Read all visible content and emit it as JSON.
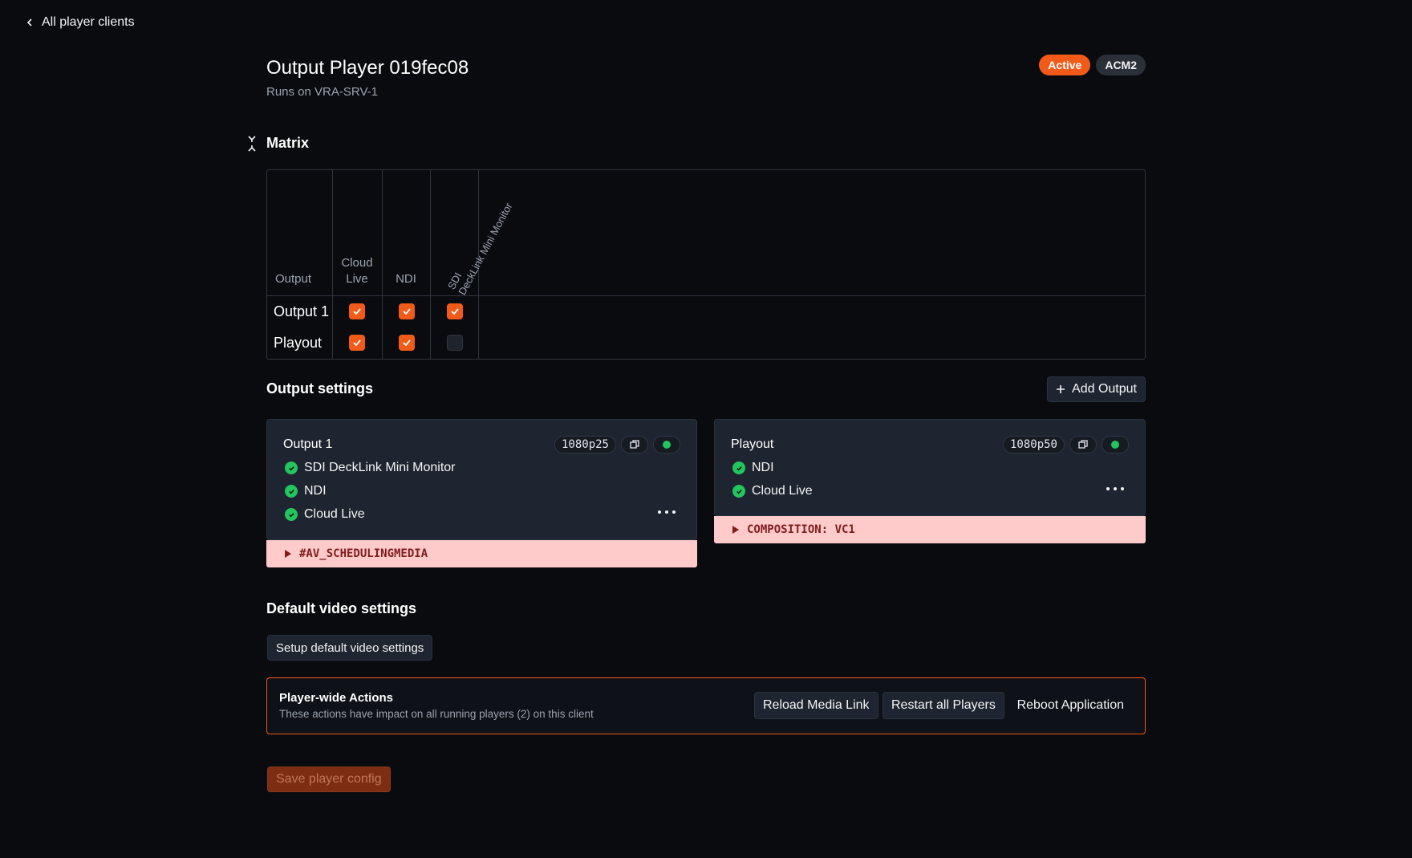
{
  "nav": {
    "back_label": "All player clients"
  },
  "header": {
    "title": "Output Player 019fec08",
    "subtitle": "Runs on VRA-SRV-1",
    "badges": {
      "status": "Active",
      "tag": "ACM2"
    },
    "colors": {
      "accent": "#f25a1a",
      "success": "#22c55e",
      "warning_bg": "#fecaca",
      "warning_text": "#7f1d1d"
    }
  },
  "matrix": {
    "title": "Matrix",
    "headers": {
      "output": "Output",
      "cloud_live_1": "Cloud",
      "cloud_live_2": "Live",
      "ndi": "NDI",
      "sdi_1": "SDI",
      "sdi_2": "DeckLink Mini Monitor"
    },
    "rows": [
      {
        "label": "Output 1",
        "cloud_live": true,
        "ndi": true,
        "sdi": true
      },
      {
        "label": "Playout",
        "cloud_live": true,
        "ndi": true,
        "sdi": false
      }
    ]
  },
  "output_settings": {
    "title": "Output settings",
    "add_label": "Add Output",
    "cards": [
      {
        "title": "Output 1",
        "resolution": "1080p25",
        "items": [
          "SDI DeckLink Mini Monitor",
          "NDI",
          "Cloud Live"
        ],
        "warning": "#AV_SCHEDULINGMEDIA"
      },
      {
        "title": "Playout",
        "resolution": "1080p50",
        "items": [
          "NDI",
          "Cloud Live"
        ],
        "warning": "COMPOSITION: VC1"
      }
    ]
  },
  "default_video": {
    "title": "Default video settings",
    "button_label": "Setup default video settings"
  },
  "player_actions": {
    "title": "Player-wide Actions",
    "description": "These actions have impact on all running players (2) on this client",
    "reload_label": "Reload Media Link",
    "restart_label": "Restart all Players",
    "reboot_label": "Reboot Application"
  },
  "footer": {
    "save_label": "Save player config"
  }
}
